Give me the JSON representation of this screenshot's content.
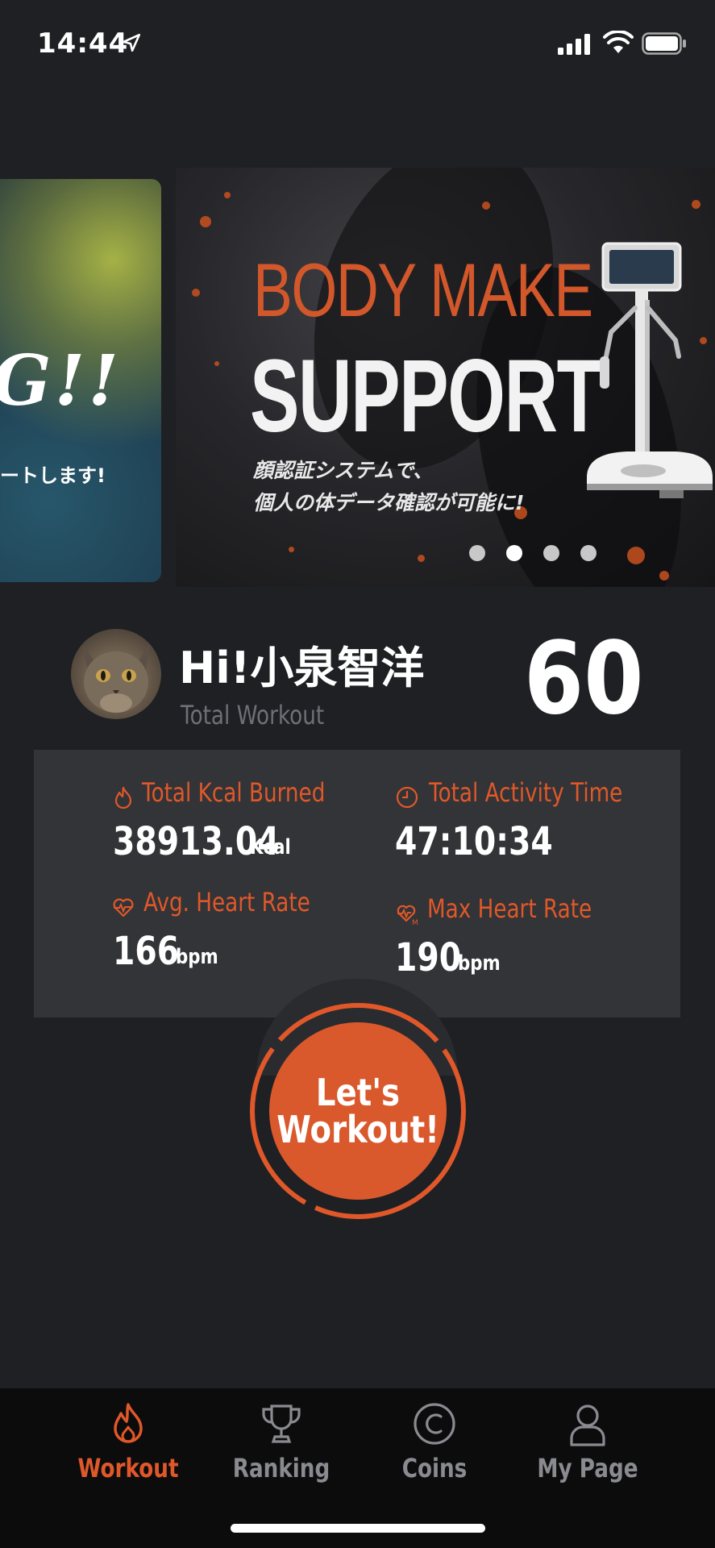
{
  "status_bar": {
    "time": "14:44"
  },
  "carousel": {
    "prev_banner": {
      "headline": "G!!",
      "subtitle": "ートします!"
    },
    "current_banner": {
      "title_line1": "BODY MAKE",
      "title_line2": "SUPPORT",
      "text_line1": "顔認証システムで、",
      "text_line2": "個人の体データ確認が可能に!"
    },
    "page_count": 4,
    "active_index": 1
  },
  "profile": {
    "greeting": "Hi!小泉智洋",
    "total_workout_label": "Total Workout",
    "total_workout_value": "60"
  },
  "stats": {
    "kcal": {
      "label": "Total Kcal Burned",
      "value": "38913.04",
      "unit": "Kcal"
    },
    "activity_time": {
      "label": "Total Activity Time",
      "value": "47:10:34"
    },
    "avg_heart_rate": {
      "label": "Avg. Heart Rate",
      "value": "166",
      "unit": "bpm"
    },
    "max_heart_rate": {
      "label": "Max Heart Rate",
      "value": "190",
      "unit": "bpm"
    }
  },
  "workout_button": {
    "line1": "Let's",
    "line2": "Workout!"
  },
  "tabbar": {
    "items": [
      {
        "label": "Workout",
        "icon": "flame-icon",
        "active": true
      },
      {
        "label": "Ranking",
        "icon": "trophy-icon",
        "active": false
      },
      {
        "label": "Coins",
        "icon": "coin-icon",
        "active": false
      },
      {
        "label": "My Page",
        "icon": "person-icon",
        "active": false
      }
    ]
  },
  "colors": {
    "accent": "#e0582a",
    "background": "#1f2023",
    "panel": "#323437",
    "tabbar": "#0c0c0d",
    "inactive": "#8a8b90"
  }
}
